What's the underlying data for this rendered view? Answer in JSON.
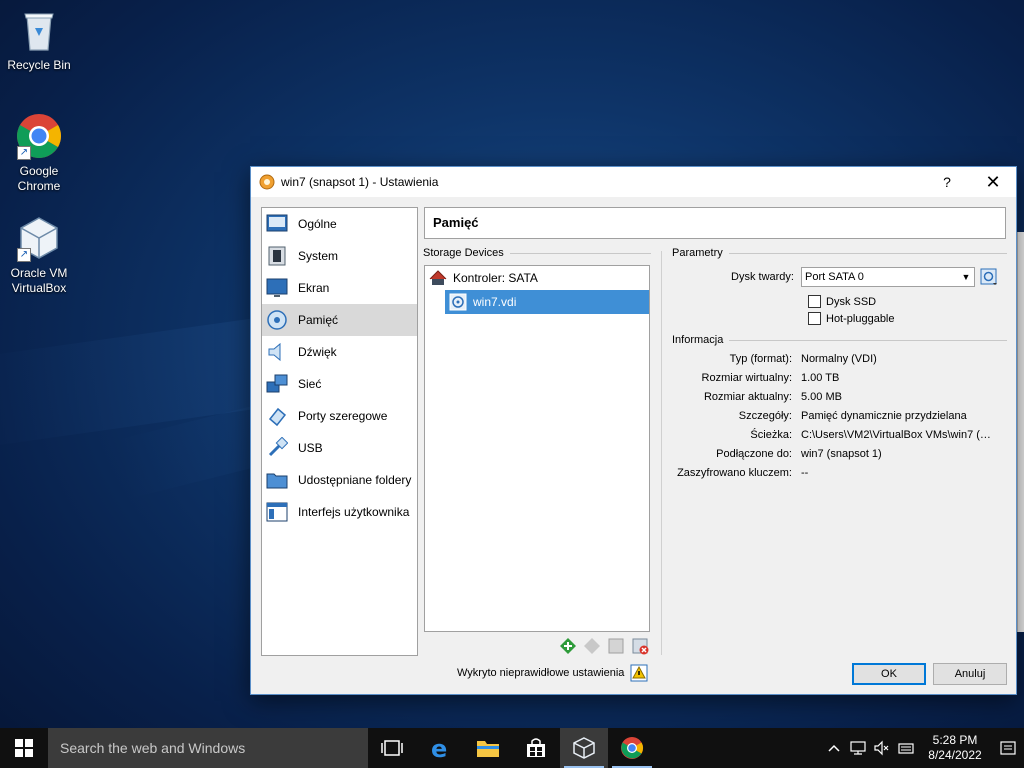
{
  "desktop": {
    "icons": [
      {
        "label": "Recycle Bin",
        "icon": "recycle-bin-icon"
      },
      {
        "label": "Google Chrome",
        "icon": "chrome-icon"
      },
      {
        "label": "Oracle VM VirtualBox",
        "icon": "virtualbox-icon"
      }
    ]
  },
  "dialog": {
    "title": "win7 (snapsot 1) - Ustawienia",
    "help": "?",
    "close": "✕",
    "categories": [
      {
        "label": "Ogólne",
        "icon": "general-icon"
      },
      {
        "label": "System",
        "icon": "system-icon"
      },
      {
        "label": "Ekran",
        "icon": "display-icon"
      },
      {
        "label": "Pamięć",
        "icon": "storage-icon"
      },
      {
        "label": "Dźwięk",
        "icon": "audio-icon"
      },
      {
        "label": "Sieć",
        "icon": "network-icon"
      },
      {
        "label": "Porty szeregowe",
        "icon": "serial-ports-icon"
      },
      {
        "label": "USB",
        "icon": "usb-icon"
      },
      {
        "label": "Udostępniane foldery",
        "icon": "shared-folders-icon"
      },
      {
        "label": "Interfejs użytkownika",
        "icon": "user-interface-icon"
      }
    ],
    "selected_category": "Pamięć",
    "page_title": "Pamięć",
    "storage": {
      "group_label": "Storage Devices",
      "controller": "Kontroler: SATA",
      "disk": "win7.vdi"
    },
    "parameters": {
      "group_label": "Parametry",
      "hard_disk_label": "Dysk twardy:",
      "hard_disk_value": "Port SATA 0",
      "ssd_label": "Dysk SSD",
      "ssd_checked": false,
      "hotplug_label": "Hot-pluggable",
      "hotplug_checked": false
    },
    "info": {
      "group_label": "Informacja",
      "rows": [
        {
          "label": "Typ (format):",
          "value": "Normalny (VDI)"
        },
        {
          "label": "Rozmiar wirtualny:",
          "value": "1.00 TB"
        },
        {
          "label": "Rozmiar aktualny:",
          "value": "5.00 MB"
        },
        {
          "label": "Szczegóły:",
          "value": "Pamięć dynamicznie przydzielana"
        },
        {
          "label": "Ścieżka:",
          "value": "C:\\Users\\VM2\\VirtualBox VMs\\win7 (sn..."
        },
        {
          "label": "Podłączone do:",
          "value": "win7 (snapsot 1)"
        },
        {
          "label": "Zaszyfrowano kluczem:",
          "value": "--"
        }
      ]
    },
    "warning": "Wykryto nieprawidłowe ustawienia",
    "ok_label": "OK",
    "cancel_label": "Anuluj"
  },
  "taskbar": {
    "search_placeholder": "Search the web and Windows",
    "apps": [
      "task-view-icon",
      "edge-icon",
      "file-explorer-icon",
      "store-icon",
      "virtualbox-icon",
      "chrome-icon"
    ],
    "time": "5:28 PM",
    "date": "8/24/2022"
  },
  "colors": {
    "selection": "#3f8fd6",
    "accent": "#0078d7"
  }
}
